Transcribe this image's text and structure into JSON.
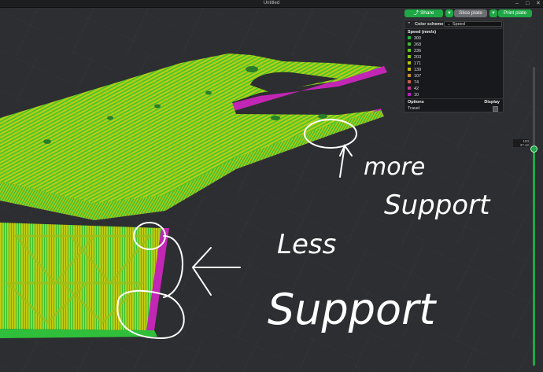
{
  "window": {
    "title": "Untitled",
    "controls": [
      "–",
      "□",
      "✕"
    ]
  },
  "toolbar": {
    "share_label": "Share",
    "share_icon": "share-icon",
    "slice_label": "Slice plate",
    "print_label": "Print plate",
    "dropdown_icon": "chevron-down-icon",
    "accent_color": "#1fa746"
  },
  "legend": {
    "header_label": "Color scheme",
    "scheme_value": "Speed",
    "speed_title": "Speed (mm/s)",
    "items": [
      {
        "label": "300",
        "color": "#1fb543"
      },
      {
        "label": "268",
        "color": "#3fbb2f"
      },
      {
        "label": "236",
        "color": "#66c21d"
      },
      {
        "label": "203",
        "color": "#8dc715"
      },
      {
        "label": "171",
        "color": "#b4c70e"
      },
      {
        "label": "139",
        "color": "#c9bb12"
      },
      {
        "label": "107",
        "color": "#c98e2a"
      },
      {
        "label": "74",
        "color": "#c95f4a"
      },
      {
        "label": "42",
        "color": "#c0398b"
      },
      {
        "label": "10",
        "color": "#b51fbf"
      }
    ],
    "options_label": "Options",
    "display_label": "Display",
    "travel_label": "Travel"
  },
  "layer_slider": {
    "top_value": "183",
    "top_height": "37.42"
  },
  "annotations": {
    "upper_text_1": "more",
    "upper_text_2": "Support",
    "lower_text_1": "Less",
    "lower_text_2": "Support"
  }
}
